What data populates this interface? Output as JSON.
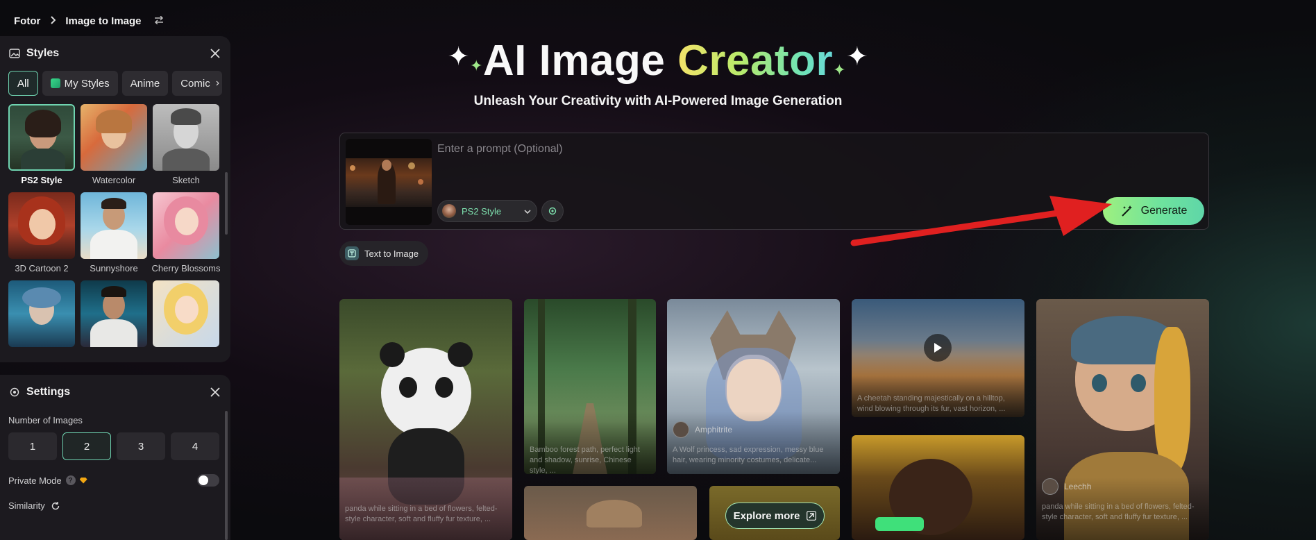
{
  "breadcrumb": {
    "root": "Fotor",
    "current": "Image to Image"
  },
  "styles_panel": {
    "title": "Styles",
    "chips": [
      {
        "label": "All",
        "active": true
      },
      {
        "label": "My Styles",
        "active": false
      },
      {
        "label": "Anime",
        "active": false
      },
      {
        "label": "Comic",
        "active": false
      }
    ],
    "items": [
      {
        "label": "PS2 Style",
        "selected": true
      },
      {
        "label": "Watercolor",
        "selected": false
      },
      {
        "label": "Sketch",
        "selected": false
      },
      {
        "label": "3D Cartoon 2",
        "selected": false
      },
      {
        "label": "Sunnyshore",
        "selected": false
      },
      {
        "label": "Cherry Blossoms",
        "selected": false
      }
    ]
  },
  "settings_panel": {
    "title": "Settings",
    "number_of_images_label": "Number of Images",
    "number_options": [
      "1",
      "2",
      "3",
      "4"
    ],
    "selected_number": "2",
    "private_mode_label": "Private Mode",
    "private_mode_on": false,
    "similarity_label": "Similarity"
  },
  "hero": {
    "title_white": "AI Image",
    "title_gradient": "Creator",
    "subtitle": "Unleash Your Creativity with AI-Powered Image Generation"
  },
  "prompt": {
    "placeholder": "Enter a prompt (Optional)",
    "value": "",
    "style_selected": "PS2 Style",
    "generate_label": "Generate"
  },
  "text_to_image_label": "Text to Image",
  "gallery": {
    "cards": [
      {
        "caption": "panda while sitting in a bed of flowers, felted-style character, soft and fluffy fur texture, ..."
      },
      {
        "caption": "Bamboo forest path, perfect light and shadow, sunrise, Chinese style, ..."
      },
      {
        "user": "Amphitrite",
        "caption": "A Wolf princess, sad expression, messy blue hair, wearing minority costumes, delicate..."
      },
      {
        "caption": "A cheetah standing majestically on a hilltop, wind blowing through its fur, vast horizon, ..."
      },
      {
        "user": "Leechh",
        "caption": "panda while sitting in a bed of flowers, felted-style character, soft and fluffy fur texture, ..."
      }
    ],
    "explore_label": "Explore more"
  },
  "colors": {
    "accent": "#6fd3b0",
    "generate_start": "#9ef07f",
    "generate_end": "#5fd6a8",
    "arrow": "#e02020"
  },
  "icons": [
    "chevron-right-icon",
    "swap-icon",
    "image-styles-icon",
    "close-icon",
    "gear-icon",
    "help-icon",
    "diamond-icon",
    "refresh-icon",
    "magic-wand-icon",
    "text-to-image-icon",
    "play-icon",
    "arrow-up-right-icon"
  ]
}
